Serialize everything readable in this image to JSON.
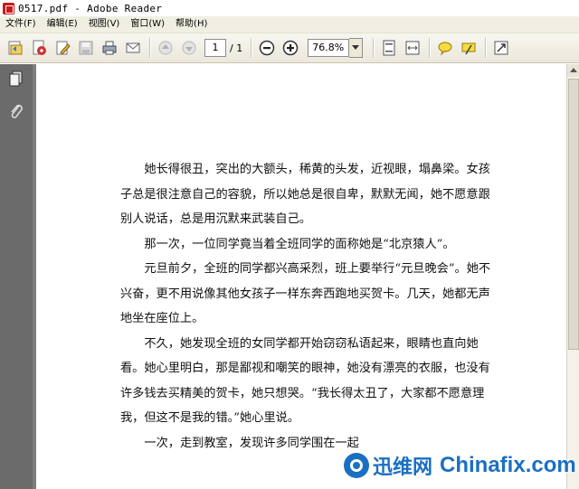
{
  "window": {
    "title": "0517.pdf - Adobe Reader"
  },
  "menu": [
    {
      "label": "文件(F)"
    },
    {
      "label": "编辑(E)"
    },
    {
      "label": "视图(V)"
    },
    {
      "label": "窗口(W)"
    },
    {
      "label": "帮助(H)"
    }
  ],
  "toolbar": {
    "page_current": "1",
    "page_total": "/ 1",
    "zoom": "76.8%"
  },
  "document": {
    "paragraphs": [
      "她长得很丑，突出的大额头，稀黄的头发，近视眼，塌鼻梁。女孩子总是很注意自己的容貌，所以她总是很自卑，默默无闻，她不愿意跟别人说话，总是用沉默来武装自己。",
      "那一次，一位同学竟当着全班同学的面称她是“北京猿人”。",
      "元旦前夕，全班的同学都兴高采烈，班上要举行“元旦晚会”。她不兴奋，更不用说像其他女孩子一样东奔西跑地买贺卡。几天，她都无声地坐在座位上。",
      "不久，她发现全班的女同学都开始窃窃私语起来，眼睛也直向她看。她心里明白，那是鄙视和嘲笑的眼神，她没有漂亮的衣服，也没有许多钱去买精美的贺卡，她只想哭。“我长得太丑了，大家都不愿意理我，但这不是我的错。”她心里说。",
      "一次，走到教室，发现许多同学围在一起"
    ]
  },
  "watermark": {
    "cn": "迅维网",
    "en": "Chinafix.com"
  },
  "colors": {
    "nav_pane": "#6b6b6b",
    "doc_bg": "#7e7e7e",
    "watermark": "#1a6fc2"
  }
}
